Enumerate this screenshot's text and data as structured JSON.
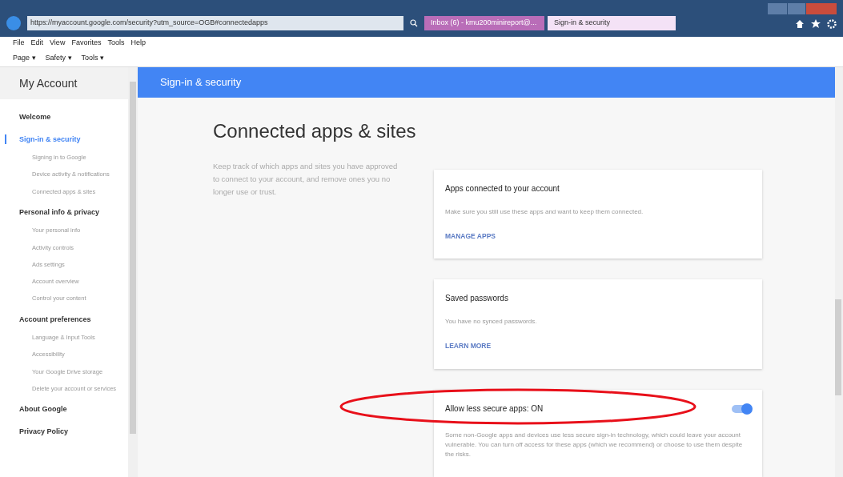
{
  "browser": {
    "address": "https://myaccount.google.com/security?utm_source=OGB#connectedapps",
    "tabs": [
      {
        "title": "Inbox (6) - kmu200minireport@...",
        "selected": false
      },
      {
        "title": "Sign-in & security",
        "selected": true
      }
    ],
    "menu": [
      "File",
      "Edit",
      "View",
      "Favorites",
      "Tools",
      "Help"
    ],
    "commands": [
      "Page ▾",
      "Safety ▾",
      "Tools ▾"
    ]
  },
  "sidebar": {
    "title": "My Account",
    "sections": [
      {
        "label": "Welcome",
        "selected": false
      },
      {
        "label": "Sign-in & security",
        "selected": true,
        "children": [
          {
            "label": "Signing in to Google"
          },
          {
            "label": "Device activity & notifications"
          },
          {
            "label": "Connected apps & sites"
          }
        ]
      },
      {
        "label": "Personal info & privacy",
        "selected": false,
        "children": [
          {
            "label": "Your personal info"
          },
          {
            "label": "Activity controls"
          },
          {
            "label": "Ads settings"
          },
          {
            "label": "Account overview"
          },
          {
            "label": "Control your content"
          }
        ]
      },
      {
        "label": "Account preferences",
        "selected": false,
        "children": [
          {
            "label": "Language & Input Tools"
          },
          {
            "label": "Accessibility"
          },
          {
            "label": "Your Google Drive storage"
          },
          {
            "label": "Delete your account or services"
          }
        ]
      },
      {
        "label": "About Google",
        "selected": false
      },
      {
        "label": "Privacy Policy",
        "selected": false
      }
    ]
  },
  "header": {
    "title": "Sign-in & security"
  },
  "section": {
    "title": "Connected apps & sites",
    "description": "Keep track of which apps and sites you have approved to connect to your account, and remove ones you no longer use or trust."
  },
  "cards": [
    {
      "kind": "link",
      "title": "Apps connected to your account",
      "text": "Make sure you still use these apps and want to keep them connected.",
      "link": "MANAGE APPS"
    },
    {
      "kind": "link",
      "title": "Saved passwords",
      "text": "You have no synced passwords.",
      "link": "LEARN MORE"
    },
    {
      "kind": "toggle",
      "title": "Allow less secure apps: ON",
      "text": "Some non-Google apps and devices use less secure sign-in technology, which could leave your account vulnerable. You can turn off access for these apps (which we recommend) or choose to use them despite the risks.",
      "on": true,
      "highlighted": true
    }
  ]
}
